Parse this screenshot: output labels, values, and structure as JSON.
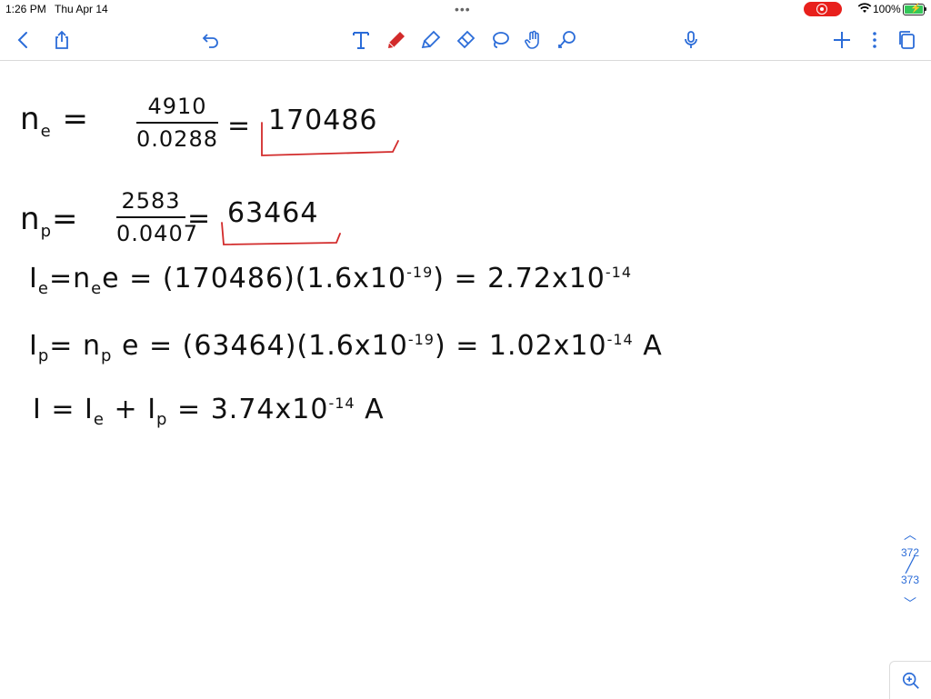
{
  "status": {
    "time": "1:26 PM",
    "date": "Thu Apr 14",
    "battery": "100%"
  },
  "toolbar": {
    "left_icons": [
      "back-chevron-icon",
      "share-icon",
      "undo-icon"
    ],
    "center_icons": [
      "text-tool-icon",
      "pen-tool-icon",
      "highlighter-icon",
      "eraser-icon",
      "lasso-icon",
      "hand-touch-icon",
      "shapes-icon"
    ],
    "right_icons": [
      "microphone-icon",
      "add-icon",
      "more-icon",
      "pages-icon"
    ],
    "accent": "#2b6cd8",
    "pen_color": "#d22a2a"
  },
  "notes": {
    "line1": {
      "lhs_main": "n",
      "lhs_sub": "e",
      "eq": "=",
      "num": "4910",
      "den": "0.0288",
      "eq2": "=",
      "result": "170486"
    },
    "line2": {
      "lhs_main": "n",
      "lhs_sub": "p",
      "eq": "=",
      "num": "2583",
      "den": "0.0407",
      "eq2": "=",
      "result": "63464"
    },
    "line3": {
      "text": "I",
      "sub": "e",
      "mid": "=n",
      "mid_sub": "e",
      "rest": "e = (170486)(1.6x10",
      "exp": "-19",
      "tail": ") = 2.72x10",
      "exp2": "-14"
    },
    "line4": {
      "text": "I",
      "sub": "p",
      "mid": "= n",
      "mid_sub": "p",
      "rest": " e = (63464)(1.6x10",
      "exp": "-19",
      "tail": ") = 1.02x10",
      "exp2": "-14",
      "unit": "A"
    },
    "line5": {
      "text": "I = I",
      "sub": "e",
      "mid": " + I",
      "mid_sub": "p",
      "rest": " = ",
      "value": "3.74x10",
      "exp": "-14",
      "unit": " A"
    },
    "ink_color": "#111111"
  },
  "pager": {
    "current": "372",
    "total": "373"
  }
}
